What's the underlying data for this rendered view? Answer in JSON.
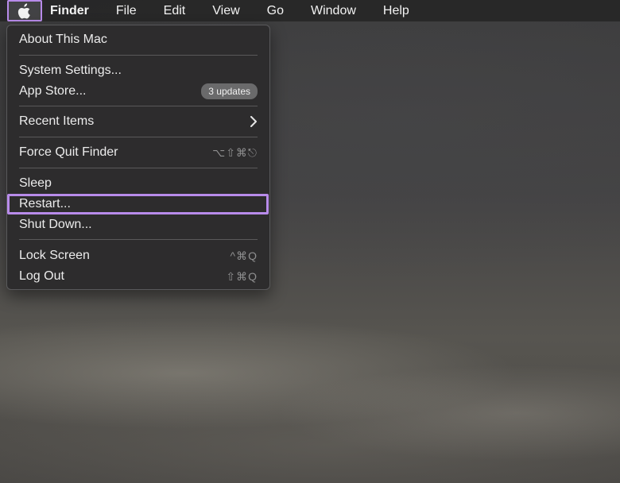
{
  "menubar": {
    "apple_icon": "apple-logo-icon",
    "items": [
      "Finder",
      "File",
      "Edit",
      "View",
      "Go",
      "Window",
      "Help"
    ]
  },
  "apple_menu": {
    "about": "About This Mac",
    "system_settings": "System Settings...",
    "app_store": "App Store...",
    "app_store_badge": "3 updates",
    "recent_items": "Recent Items",
    "force_quit": "Force Quit Finder",
    "force_quit_shortcut": "⌥⇧⌘⎋",
    "sleep": "Sleep",
    "restart": "Restart...",
    "shut_down": "Shut Down...",
    "lock_screen": "Lock Screen",
    "lock_screen_shortcut": "^⌘Q",
    "log_out": "Log Out",
    "log_out_shortcut": "⇧⌘Q"
  },
  "colors": {
    "highlight": "#b88bea",
    "menu_background": "#2c2b2c"
  }
}
